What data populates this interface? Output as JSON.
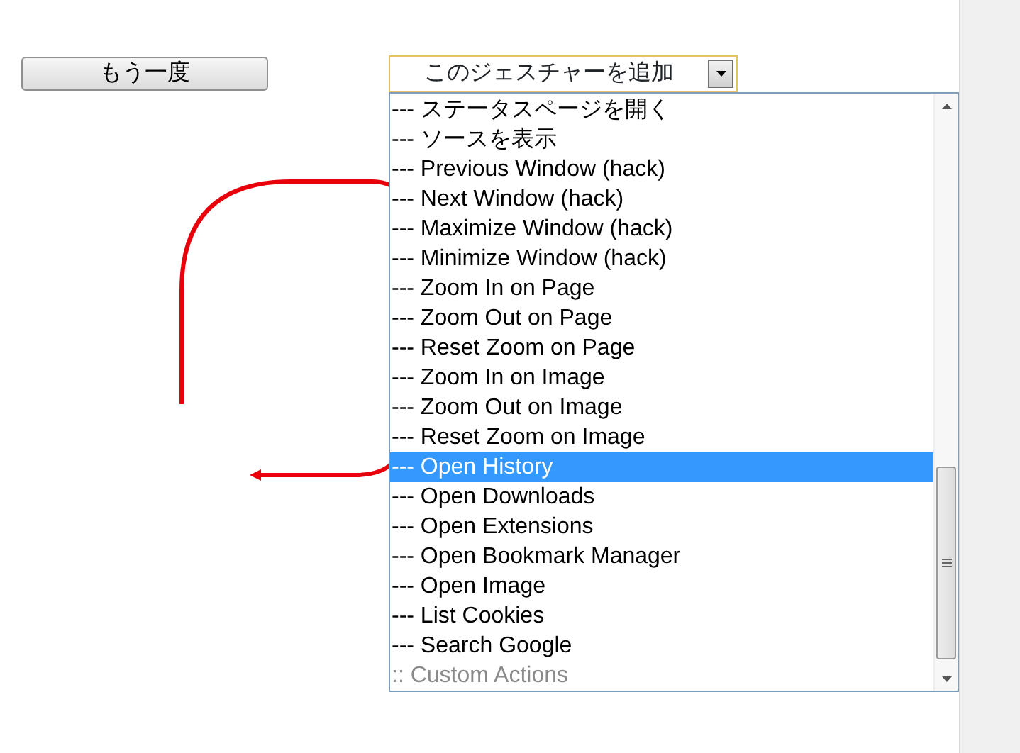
{
  "repeat_button": {
    "label": "もう一度"
  },
  "gesture_select": {
    "value": "このジェスチャーを追加",
    "expanded": true
  },
  "options": [
    {
      "label": "--- ステータスページを開く",
      "kind": "action",
      "selected": false
    },
    {
      "label": "--- ソースを表示",
      "kind": "action",
      "selected": false
    },
    {
      "label": "--- Previous Window (hack)",
      "kind": "action",
      "selected": false
    },
    {
      "label": "--- Next Window (hack)",
      "kind": "action",
      "selected": false
    },
    {
      "label": "--- Maximize Window (hack)",
      "kind": "action",
      "selected": false
    },
    {
      "label": "--- Minimize Window (hack)",
      "kind": "action",
      "selected": false
    },
    {
      "label": "--- Zoom In on Page",
      "kind": "action",
      "selected": false
    },
    {
      "label": "--- Zoom Out on Page",
      "kind": "action",
      "selected": false
    },
    {
      "label": "--- Reset Zoom on Page",
      "kind": "action",
      "selected": false
    },
    {
      "label": "--- Zoom In on Image",
      "kind": "action",
      "selected": false
    },
    {
      "label": "--- Zoom Out on Image",
      "kind": "action",
      "selected": false
    },
    {
      "label": "--- Reset Zoom on Image",
      "kind": "action",
      "selected": false
    },
    {
      "label": "--- Open History",
      "kind": "action",
      "selected": true
    },
    {
      "label": "--- Open Downloads",
      "kind": "action",
      "selected": false
    },
    {
      "label": "--- Open Extensions",
      "kind": "action",
      "selected": false
    },
    {
      "label": "--- Open Bookmark Manager",
      "kind": "action",
      "selected": false
    },
    {
      "label": "--- Open Image",
      "kind": "action",
      "selected": false
    },
    {
      "label": "--- List Cookies",
      "kind": "action",
      "selected": false
    },
    {
      "label": "--- Search Google",
      "kind": "action",
      "selected": false
    },
    {
      "label": ":: Custom Actions",
      "kind": "group",
      "selected": false
    }
  ]
}
